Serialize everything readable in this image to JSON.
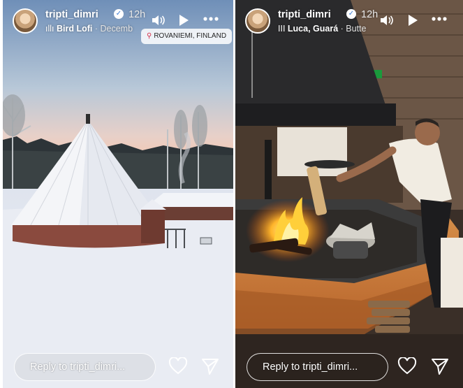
{
  "stories": [
    {
      "username": "tripti_dimri",
      "time": "12h",
      "music": {
        "song": "Bird Lofi",
        "artist": "Decemb"
      },
      "location": "ROVANIEMI, FINLAND",
      "reply_placeholder": "Reply to tripti_dimri...",
      "scene": "snowy teepee hut at dusk"
    },
    {
      "username": "tripti_dimri",
      "time": "12h",
      "music": {
        "song": "Luca, Guará",
        "artist": "Butte"
      },
      "reply_placeholder": "Reply to tripti_dimri...",
      "scene": "man cooking over indoor fire pit"
    }
  ],
  "icons": {
    "verified": "verified-badge-icon",
    "waveform": "audio-waveform-icon",
    "mute": "speaker-icon",
    "play": "play-icon",
    "more": "more-horizontal-icon",
    "pin": "location-pin-icon",
    "like": "heart-icon",
    "share": "send-icon"
  },
  "colors": {
    "accent_pin": "#d4304a",
    "verified": "#3a7bd5"
  }
}
